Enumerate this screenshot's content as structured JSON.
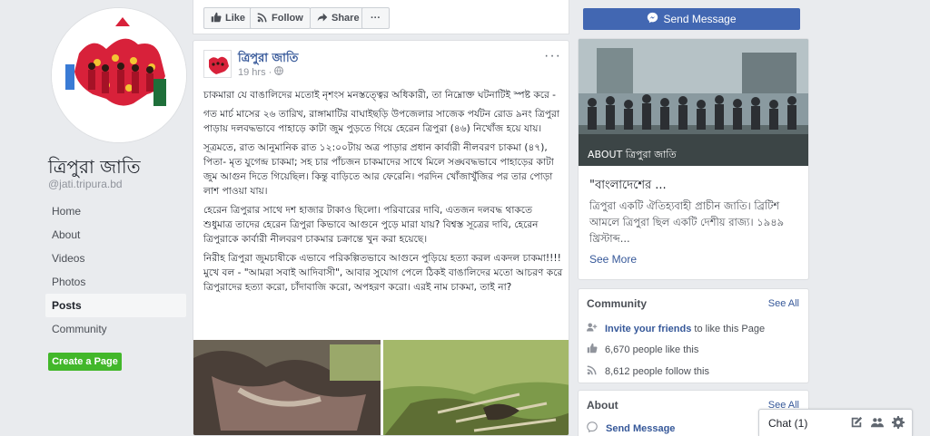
{
  "sidebar": {
    "page_name": "ত্রিপুরা জাতি",
    "handle": "@jati.tripura.bd",
    "nav": [
      "Home",
      "About",
      "Videos",
      "Photos",
      "Posts",
      "Community"
    ],
    "active_nav": "Posts",
    "create_page": "Create a Page"
  },
  "action_bar": {
    "like": "Like",
    "follow": "Follow",
    "share": "Share",
    "more": "···"
  },
  "post": {
    "author": "ত্রিপুরা জাতি",
    "time": "19 hrs · ",
    "more": "···",
    "paragraphs": [
      "চাকমারা যে বাঙালিদের মতোই নৃশংস মনস্তত্ত্বের অধিকারী, তা নিম্নোক্ত ঘটনাটিই স্পষ্ট করে -",
      "গত মার্চ মাসের ২৬ তারিখ, রাঙ্গামাটির বাঘাইছড়ি উপজেলার সাজেক পর্যটন রোড ৯নং ত্রিপুরা পাড়ায় দলবদ্ধভাবে পাহাড়ে কাটা জুম পুড়তে গিয়ে হেরেন ত্রিপুরা (৪৬) নিখোঁজ হয়ে যায়।",
      "সূত্রমতে, রাত আনুমানিক রাত ১২:০০টায় অত্র পাড়ার প্রধান কার্বারী নীলবরণ চাকমা (৪৭), পিতা- মৃত যুগেন্দ্র চাকমা; সহ চার পাঁচজন চাকমাদের সাথে মিলে সঙ্ঘবদ্ধভাবে পাহাড়ের কাটা জুম আগুন দিতে গিয়েছিল। কিন্তু বাড়িতে আর ফেরেনি। পরদিন খোঁজাখুঁজির পর তার পোড়া লাশ পাওয়া যায়।",
      "হেরেন ত্রিপুরার সাথে দশ হাজার টাকাও ছিলো। পরিবারের দাবি, এতজন দলবদ্ধ থাকতে শুধুমাত্র তাদের হেরেন ত্রিপুরা কিভাবে আগুনে পুড়ে মারা যায়? বিশ্বস্ত সূত্রের দাবি, হেরেন ত্রিপুরাকে কার্বারী নীলবরণ চাকমার চক্রান্তে খুন করা হয়েছে।",
      "নিরীহ ত্রিপুরা জুমচাষীকে এভাবে পরিকল্পিতভাবে আগুনে পুড়িয়ে হত্যা করল একদল চাকমা!!!! মুখে বল - \"আমরা সবাই আদিবাসী\", আবার সুযোগ পেলে ঠিকই বাঙালিদের মতো আচরণ করে ত্রিপুরাদের হত্যা করো, চাঁদাবাজি করো, অপহরণ করো। এরই নাম চাকমা, তাই না?"
    ]
  },
  "right": {
    "send_message": "Send Message",
    "about_photo_label": "ABOUT ত্রিপুরা জাতি",
    "about_quote": "\"বাংলাদেশের ...",
    "about_desc": "ত্রিপুরা একটি ঐতিহ্যবাহী প্রাচীন জাতি। ব্রিটিশ আমলে ত্রিপুরা ছিল একটি দেশীয় রাজ্য। ১৯৪৯ খ্রিস্টাব্দ...",
    "see_more": "See More",
    "community": {
      "title": "Community",
      "see_all": "See All",
      "invite": "Invite your friends",
      "invite_rest": " to like this Page",
      "likes": "6,670 people like this",
      "follows": "8,612 people follow this"
    },
    "about": {
      "title": "About",
      "see_all": "See All",
      "send_message": "Send Message"
    }
  },
  "chat": {
    "label": "Chat (1)"
  },
  "colors": {
    "brand": "#4267b2",
    "link": "#365899",
    "green": "#42b72a"
  }
}
